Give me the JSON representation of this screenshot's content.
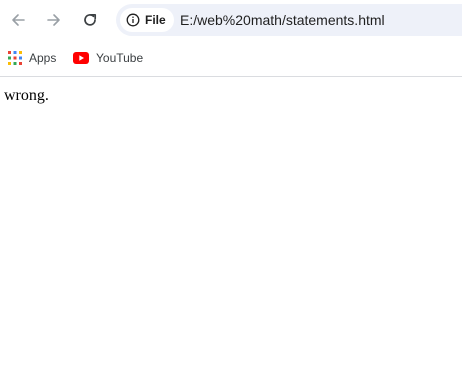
{
  "toolbar": {
    "back_icon": "arrow-left-icon",
    "forward_icon": "arrow-right-icon",
    "reload_icon": "reload-icon"
  },
  "omnibox": {
    "security_icon": "info-circle-icon",
    "chip_label": "File",
    "url": "E:/web%20math/statements.html"
  },
  "bookmarks": {
    "items": [
      {
        "label": "Apps",
        "icon": "apps-grid-icon"
      },
      {
        "label": "YouTube",
        "icon": "youtube-icon"
      }
    ]
  },
  "page": {
    "body_text": "wrong."
  },
  "colors": {
    "omnibox_bg": "#eef1f9",
    "youtube_red": "#ff0000",
    "icon_gray": "#5f6368",
    "icon_disabled": "#9aa0a6"
  }
}
